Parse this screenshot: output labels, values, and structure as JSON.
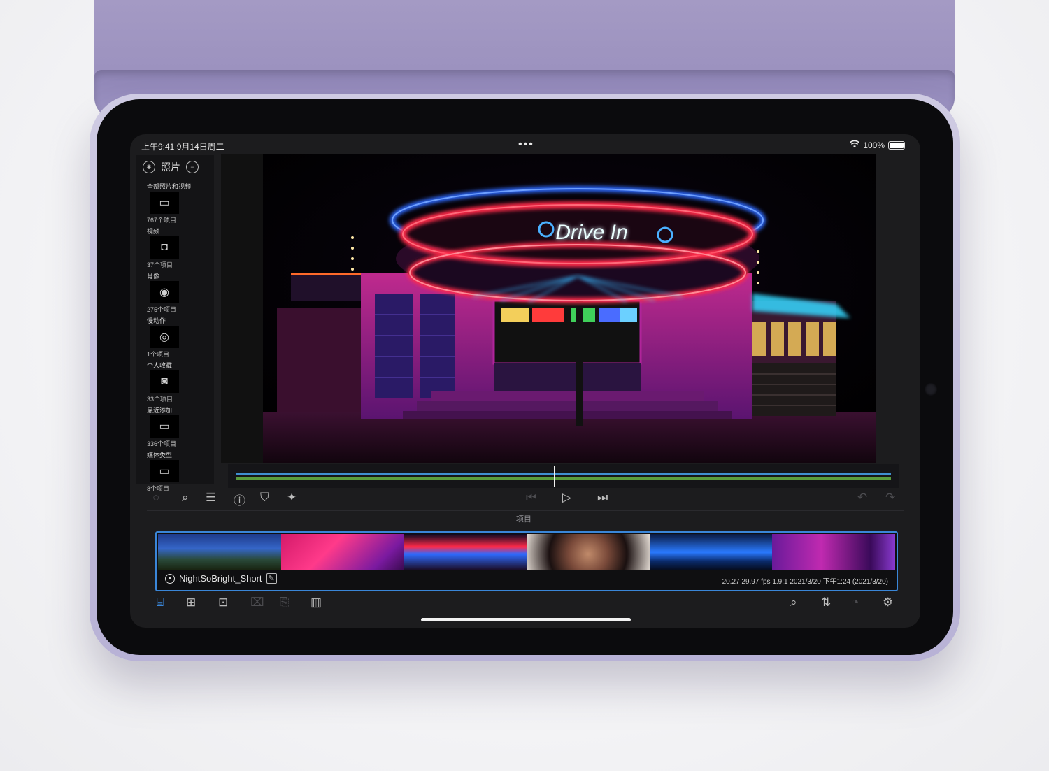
{
  "status_bar": {
    "time": "上午9:41  9月14日周二",
    "dots": "•••",
    "battery": "100%"
  },
  "sidebar": {
    "title": "照片",
    "albums": [
      {
        "title": "全部照片和视频",
        "count": "767个项目",
        "icon": "folder-icon",
        "glyph": "▭"
      },
      {
        "title": "视频",
        "count": "37个项目",
        "icon": "video-camera-icon",
        "glyph": "◘"
      },
      {
        "title": "肖像",
        "count": "275个项目",
        "icon": "camera-icon",
        "glyph": "◉"
      },
      {
        "title": "慢动作",
        "count": "1个项目",
        "icon": "slowmo-icon",
        "glyph": "◎"
      },
      {
        "title": "个人收藏",
        "count": "33个项目",
        "icon": "favorites-icon",
        "glyph": "◙"
      },
      {
        "title": "最近添加",
        "count": "336个项目",
        "icon": "recent-folder-icon",
        "glyph": "▭"
      },
      {
        "title": "媒体类型",
        "count": "8个项目",
        "icon": "media-types-icon",
        "glyph": "▭"
      }
    ]
  },
  "viewer": {
    "sign_text": "Drive In"
  },
  "controls": {
    "project_label": "项目"
  },
  "project": {
    "name": "NightSoBright_Short",
    "meta": "20.27   29.97 fps   1.9:1   2021/3/20  下午1:24  (2021/3/20)"
  },
  "colors": {
    "accent": "#3a86d8",
    "track_blue": "#3f8fd0",
    "track_green": "#5a9c3c"
  }
}
